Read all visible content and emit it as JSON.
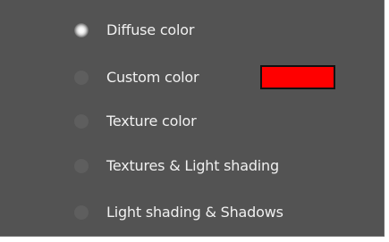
{
  "options": [
    {
      "label": "Diffuse color",
      "selected": true
    },
    {
      "label": "Custom color",
      "selected": false
    },
    {
      "label": "Texture color",
      "selected": false
    },
    {
      "label": "Textures & Light shading",
      "selected": false
    },
    {
      "label": "Light shading & Shadows",
      "selected": false
    }
  ],
  "custom_color": {
    "value": "#ff0000"
  },
  "colors": {
    "panel_background": "#535353",
    "text": "#f0f0f0",
    "radio_off": "#5e5e5e"
  }
}
